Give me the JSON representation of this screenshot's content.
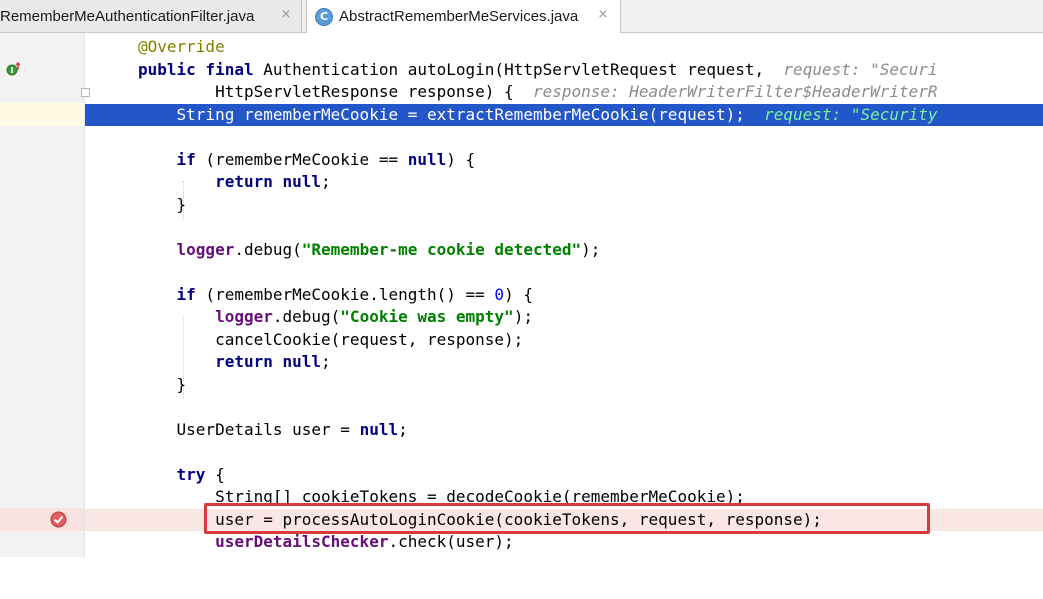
{
  "tabs": [
    {
      "label": "RememberMeAuthenticationFilter.java",
      "active": false
    },
    {
      "label": "AbstractRememberMeServices.java",
      "active": true,
      "icon": "class-icon",
      "icon_letter": "C"
    }
  ],
  "editor": {
    "lines": {
      "l1": {
        "ann": "@Override"
      },
      "l2": {
        "kw1": "public",
        "kw2": "final",
        "text": " Authentication autoLogin(HttpServletRequest request,  ",
        "hint": "request: \"Securi"
      },
      "l3": {
        "text": "        HttpServletResponse response) {  ",
        "hint": "response: HeaderWriterFilter$HeaderWriterR"
      },
      "l4": {
        "text": "    String rememberMeCookie = extractRememberMeCookie(request);  ",
        "hint": "request: \"Security"
      },
      "l6": {
        "pre": "    ",
        "kw": "if",
        "text1": " (rememberMeCookie == ",
        "kw2": "null",
        "text2": ") {"
      },
      "l7": {
        "pre": "        ",
        "kw": "return",
        "text": " ",
        "kw2": "null",
        "text2": ";"
      },
      "l8": {
        "text": "    }"
      },
      "l10": {
        "pre": "    ",
        "field": "logger",
        "text1": ".debug(",
        "str": "\"Remember-me cookie detected\"",
        "text2": ");"
      },
      "l12": {
        "pre": "    ",
        "kw": "if",
        "text1": " (rememberMeCookie.length() == ",
        "num": "0",
        "text2": ") {"
      },
      "l13": {
        "pre": "        ",
        "field": "logger",
        "text1": ".debug(",
        "str": "\"Cookie was empty\"",
        "text2": ");"
      },
      "l14": {
        "text": "        cancelCookie(request, response);"
      },
      "l15": {
        "pre": "        ",
        "kw": "return",
        "text": " ",
        "kw2": "null",
        "text2": ";"
      },
      "l16": {
        "text": "    }"
      },
      "l18": {
        "text1": "    UserDetails user = ",
        "kw": "null",
        "text2": ";"
      },
      "l20": {
        "pre": "    ",
        "kw": "try",
        "text": " {"
      },
      "l21": {
        "text": "        String[] cookieTokens = decodeCookie(rememberMeCookie);"
      },
      "l22": {
        "text": "        user = processAutoLoginCookie(cookieTokens, request, response);"
      },
      "l23": {
        "pre": "        ",
        "field": "userDetailsChecker",
        "text": ".check(user);"
      }
    }
  },
  "icons": {
    "tab_close": "×",
    "override": "override-icon",
    "breakpoint": "breakpoint-icon",
    "fold": "fold-marker"
  },
  "colors": {
    "current_line": "#2256c9",
    "breakpoint_line": "#fbe6e6",
    "keyword": "#000080",
    "string": "#008000",
    "annotation": "#808000",
    "field": "#660e7a",
    "highlight_box": "#d83b3b"
  }
}
